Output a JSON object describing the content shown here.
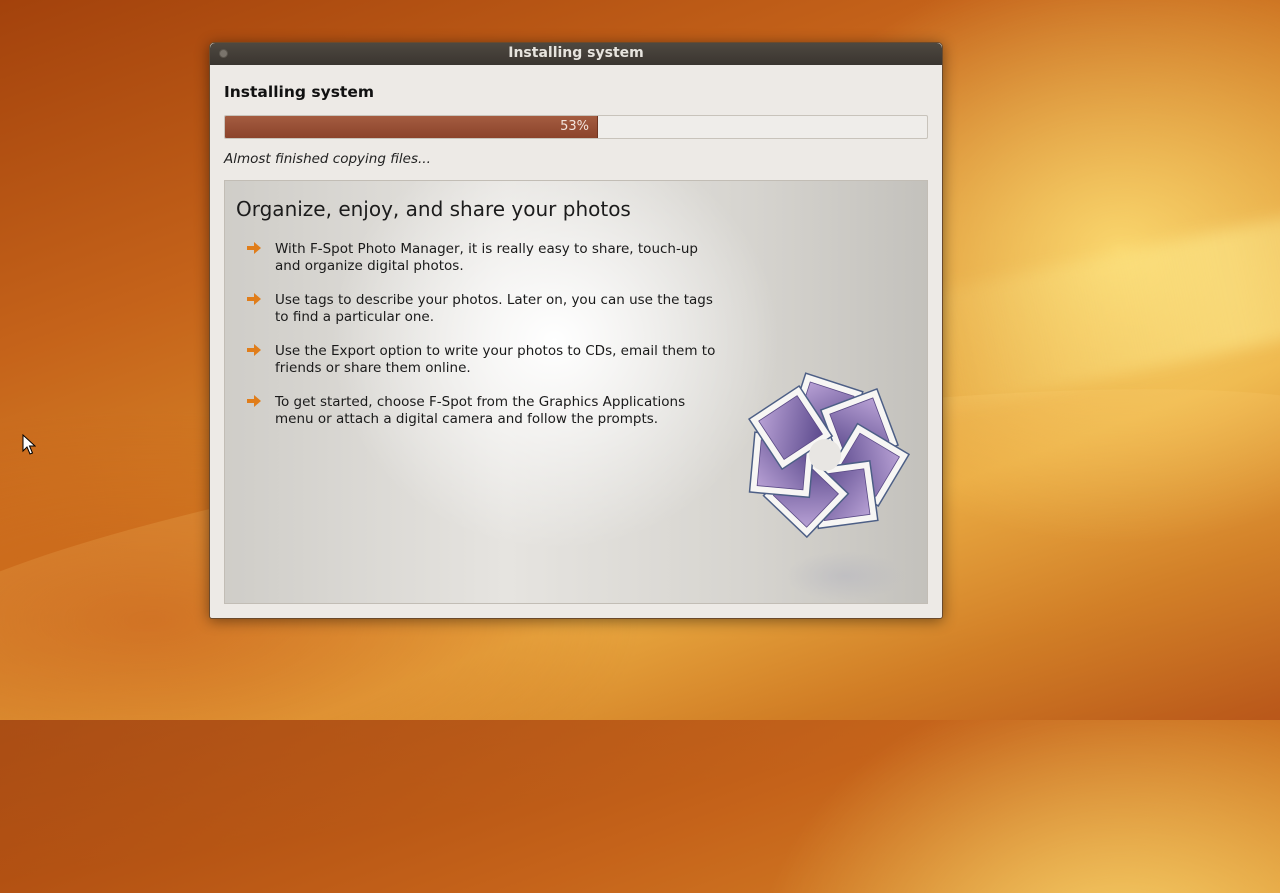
{
  "window": {
    "title": "Installing system"
  },
  "installer": {
    "heading": "Installing system",
    "progress_percent": 53,
    "progress_label": "53%",
    "status": "Almost finished copying files..."
  },
  "slide": {
    "title": "Organize, enjoy, and share your photos",
    "bullets": [
      "With F-Spot Photo Manager, it is really easy to share, touch-up and organize digital photos.",
      "Use tags to describe your photos. Later on, you can use the tags to find a particular one.",
      "Use the Export option to write your photos to CDs, email them to friends or share them online.",
      "To get started, choose F-Spot from the Graphics Applications menu or attach a digital camera and follow the prompts."
    ],
    "bullet_icon": "orange-arrow-icon",
    "logo_icon": "f-spot-logo-icon"
  },
  "colors": {
    "progress_fill": "#8b432b",
    "bullet_arrow": "#e07d1a",
    "titlebar": "#3d3833"
  }
}
